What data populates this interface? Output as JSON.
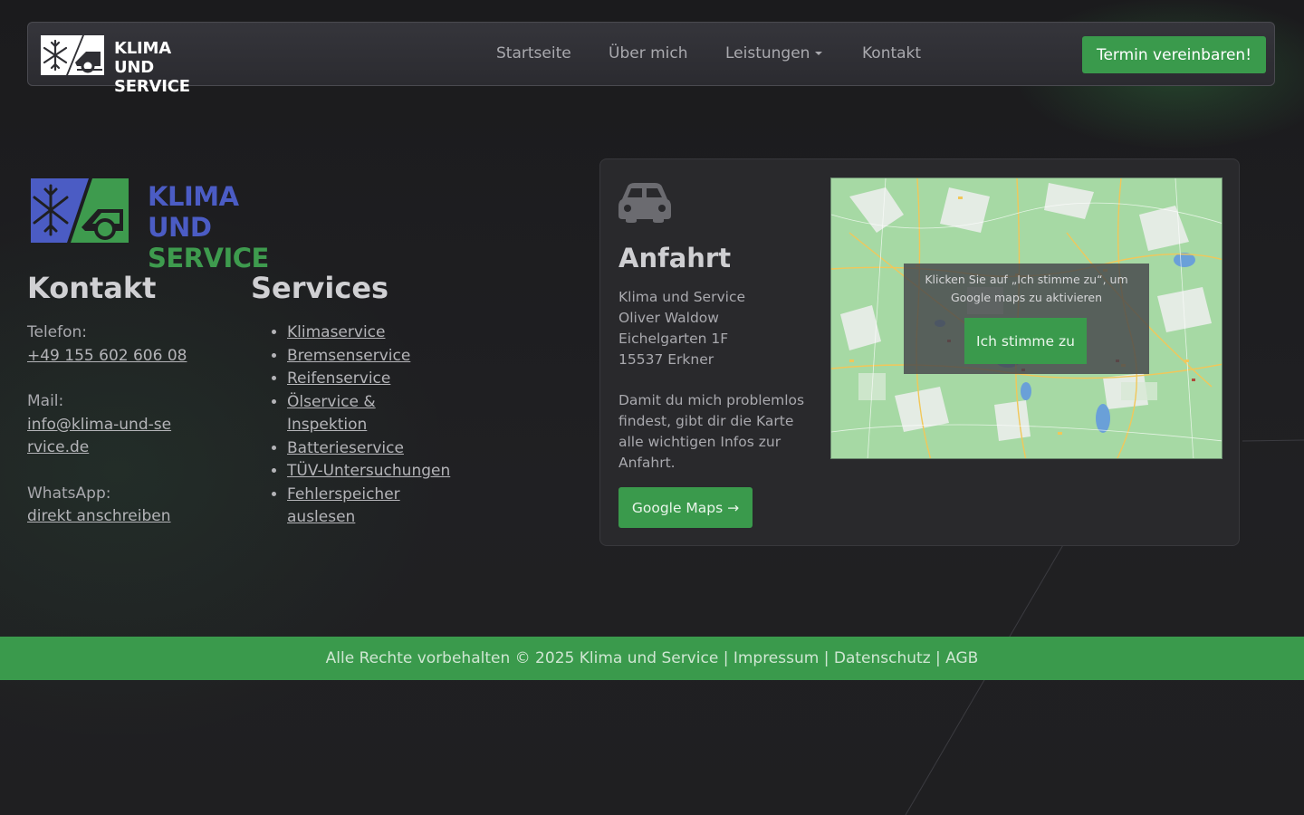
{
  "nav": {
    "logo_line1": "KLIMA UND",
    "logo_line2": "SERVICE",
    "links": [
      {
        "label": "Startseite"
      },
      {
        "label": "Über mich"
      },
      {
        "label": "Leistungen"
      },
      {
        "label": "Kontakt"
      }
    ],
    "cta_label": "Termin vereinbaren!"
  },
  "brand": {
    "line1": "KLIMA UND",
    "line2": "SERVICE"
  },
  "contact": {
    "title": "Kontakt",
    "phone_label": "Telefon:",
    "phone_value": "+49 155 602 606 08",
    "mail_label": "Mail:",
    "mail_value": "info@klima-und-service.de",
    "whatsapp_label": "WhatsApp:",
    "whatsapp_value": "direkt anschreiben"
  },
  "services": {
    "title": "Services",
    "items": [
      {
        "label": "Klimaservice"
      },
      {
        "label": "Bremsenservice"
      },
      {
        "label": "Reifenservice"
      },
      {
        "label": "Ölservice & Inspektion"
      },
      {
        "label": "Batterieservice"
      },
      {
        "label": "TÜV-Untersuchungen"
      },
      {
        "label": "Fehlerspeicher auslesen"
      }
    ]
  },
  "anfahrt": {
    "icon": "car-icon",
    "title": "Anfahrt",
    "address": [
      "Klima und Service",
      "Oliver Waldow",
      "Eichelgarten 1F",
      "15537 Erkner"
    ],
    "description": "Damit du mich problemlos findest, gibt dir die Karte alle wichtigen Infos zur Anfahrt.",
    "button_label": "Google Maps →",
    "map_consent_text": "Klicken Sie auf „Ich stimme zu“, um Google maps zu aktivieren",
    "map_consent_button": "Ich stimme zu"
  },
  "footer": {
    "copyright": "Alle Rechte vorbehalten © 2025 Klima und Service",
    "separator": "|",
    "links": [
      {
        "label": "Impressum"
      },
      {
        "label": "Datenschutz"
      },
      {
        "label": "AGB"
      }
    ]
  },
  "colors": {
    "accent_green": "#3a9a4c",
    "brand_blue": "#4b5cc4",
    "background": "#1f1f21"
  }
}
